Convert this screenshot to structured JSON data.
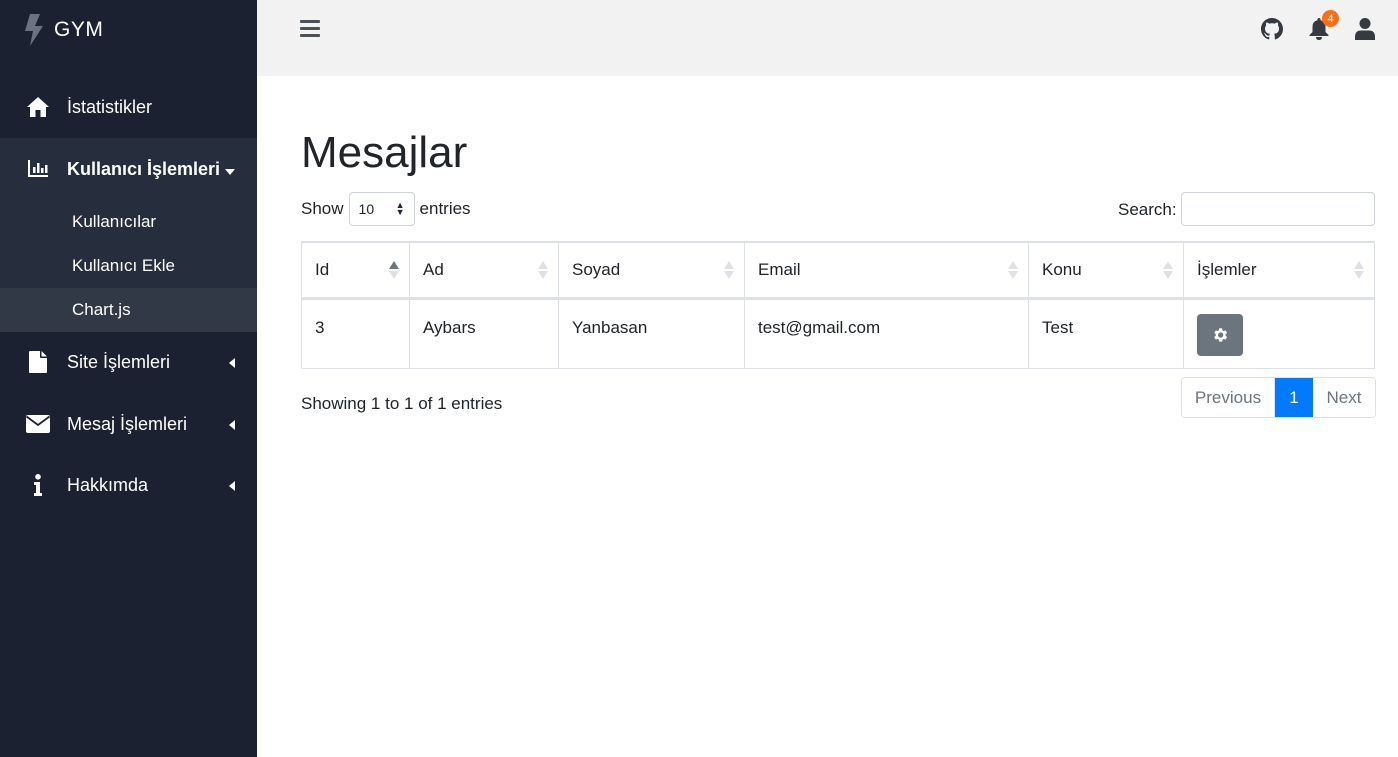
{
  "brand": {
    "name": "GYM",
    "icon": "bolt-icon"
  },
  "sidebar": {
    "items": [
      {
        "label": "İstatistikler",
        "icon": "home-icon"
      },
      {
        "label": "Kullanıcı İşlemleri",
        "icon": "chart-icon",
        "caret": "down"
      },
      {
        "label": "Site İşlemleri",
        "icon": "file-icon",
        "caret": "left"
      },
      {
        "label": "Mesaj İşlemleri",
        "icon": "envelope-icon",
        "caret": "left"
      },
      {
        "label": "Hakkımda",
        "icon": "info-icon",
        "caret": "left"
      }
    ],
    "subitems": [
      {
        "label": "Kullanıcılar"
      },
      {
        "label": "Kullanıcı Ekle"
      },
      {
        "label": "Chart.js"
      }
    ]
  },
  "topbar": {
    "notification_count": "4"
  },
  "page": {
    "title": "Mesajlar",
    "show_label": "Show",
    "entries_label": "entries",
    "page_length": "10",
    "search_label": "Search:",
    "search_value": ""
  },
  "table": {
    "headers": [
      "Id",
      "Ad",
      "Soyad",
      "Email",
      "Konu",
      "İşlemler"
    ],
    "rows": [
      [
        "3",
        "Aybars",
        "Yanbasan",
        "test@gmail.com",
        "Test"
      ]
    ]
  },
  "footer": {
    "info": "Showing 1 to 1 of 1 entries",
    "previous": "Previous",
    "current_page": "1",
    "next": "Next"
  },
  "colors": {
    "sidebar_bg": "#1b2130",
    "topbar_bg": "#f2f2f2",
    "primary": "#007bff",
    "badge": "#fd6e14",
    "secondary_btn": "#6c757d"
  }
}
